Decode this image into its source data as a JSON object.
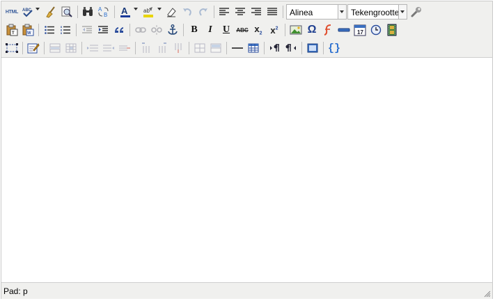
{
  "toolbar": {
    "html_label": "HTML",
    "format_select": {
      "value": "Alinea"
    },
    "fontsize_select": {
      "value": "Tekengrootte"
    },
    "abc_label": "ABC",
    "sub_label": "x",
    "sub_index": "2",
    "sup_label": "x",
    "sup_index": "2",
    "omega_label": "Ω",
    "bold_label": "B",
    "italic_label": "I",
    "underline_label": "U",
    "code_label": "{}"
  },
  "statusbar": {
    "path_label": "Pad: p"
  }
}
